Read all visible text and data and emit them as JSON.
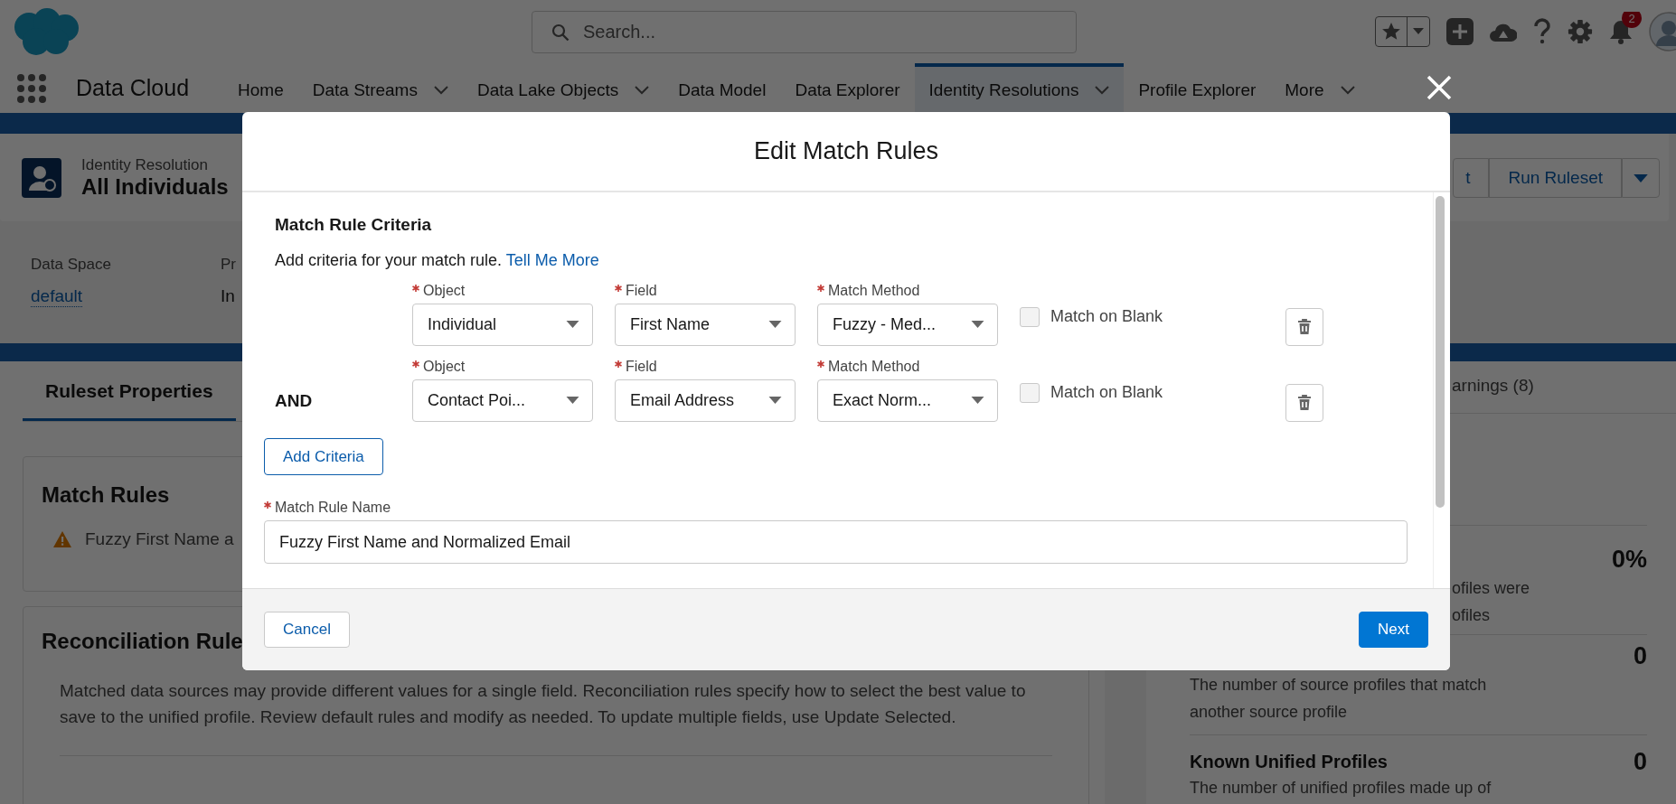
{
  "header": {
    "search": {
      "placeholder": "Search..."
    },
    "notifications": {
      "count": "2"
    }
  },
  "app_nav": {
    "app_name": "Data Cloud",
    "tabs": [
      {
        "label": "Home",
        "has_menu": false,
        "selected": false
      },
      {
        "label": "Data Streams",
        "has_menu": true,
        "selected": false
      },
      {
        "label": "Data Lake Objects",
        "has_menu": true,
        "selected": false
      },
      {
        "label": "Data Model",
        "has_menu": false,
        "selected": false
      },
      {
        "label": "Data Explorer",
        "has_menu": false,
        "selected": false
      },
      {
        "label": "Identity Resolutions",
        "has_menu": true,
        "selected": true
      },
      {
        "label": "Profile Explorer",
        "has_menu": false,
        "selected": false
      },
      {
        "label": "More",
        "has_menu": true,
        "selected": false
      }
    ]
  },
  "page_header": {
    "object_type": "Identity Resolution",
    "title": "All Individuals",
    "actions": [
      {
        "label": "t"
      },
      {
        "label": "Run Ruleset"
      }
    ]
  },
  "details": [
    {
      "label": "Data Space",
      "value": "default",
      "kind": "link"
    },
    {
      "label": "Pr",
      "value": "In",
      "kind": "text"
    }
  ],
  "left_panel": {
    "tabs": [
      {
        "label": "Ruleset Properties",
        "selected": true
      }
    ],
    "match_rules": {
      "title": "Match Rules",
      "items": [
        {
          "name": "Fuzzy First Name a",
          "warning": true
        }
      ]
    },
    "reconciliation": {
      "title": "Reconciliation Rule",
      "description": "Matched data sources may provide different values for a single field. Reconciliation rules specify how to select the best value to save to the unified profile. Review default rules and modify as needed. To update multiple fields, use Update Selected."
    }
  },
  "right_panel": {
    "tabs": [
      {
        "label": "arnings (8)",
        "selected": false
      }
    ],
    "stats": [
      {
        "value": "0%",
        "description_lines": [
          "ofiles were",
          "ofiles"
        ]
      },
      {
        "value": "0",
        "description": "The number of source profiles that match another source profile"
      },
      {
        "name": "Known Unified Profiles",
        "value": "0",
        "description": "The number of unified profiles made up of"
      }
    ]
  },
  "modal": {
    "title": "Edit Match Rules",
    "section_title": "Match Rule Criteria",
    "intro": "Add criteria for your match rule.",
    "help_link": "Tell Me More",
    "criteria": [
      {
        "fields": [
          {
            "label": "Object",
            "value": "Individual",
            "required": true
          },
          {
            "label": "Field",
            "value": "First Name",
            "required": true
          },
          {
            "label": "Match Method",
            "value": "Fuzzy - Med...",
            "required": true
          }
        ],
        "match_on_blank": {
          "label": "Match on Blank",
          "checked": false
        }
      },
      {
        "connector": "AND",
        "fields": [
          {
            "label": "Object",
            "value": "Contact Poi...",
            "required": true
          },
          {
            "label": "Field",
            "value": "Email Address",
            "required": true
          },
          {
            "label": "Match Method",
            "value": "Exact Norm...",
            "required": true
          }
        ],
        "match_on_blank": {
          "label": "Match on Blank",
          "checked": false
        }
      }
    ],
    "add_button": "Add Criteria",
    "rule_name": {
      "label": "Match Rule Name",
      "value": "Fuzzy First Name and Normalized Email",
      "required": true
    },
    "footer": {
      "cancel": "Cancel",
      "next": "Next"
    }
  }
}
